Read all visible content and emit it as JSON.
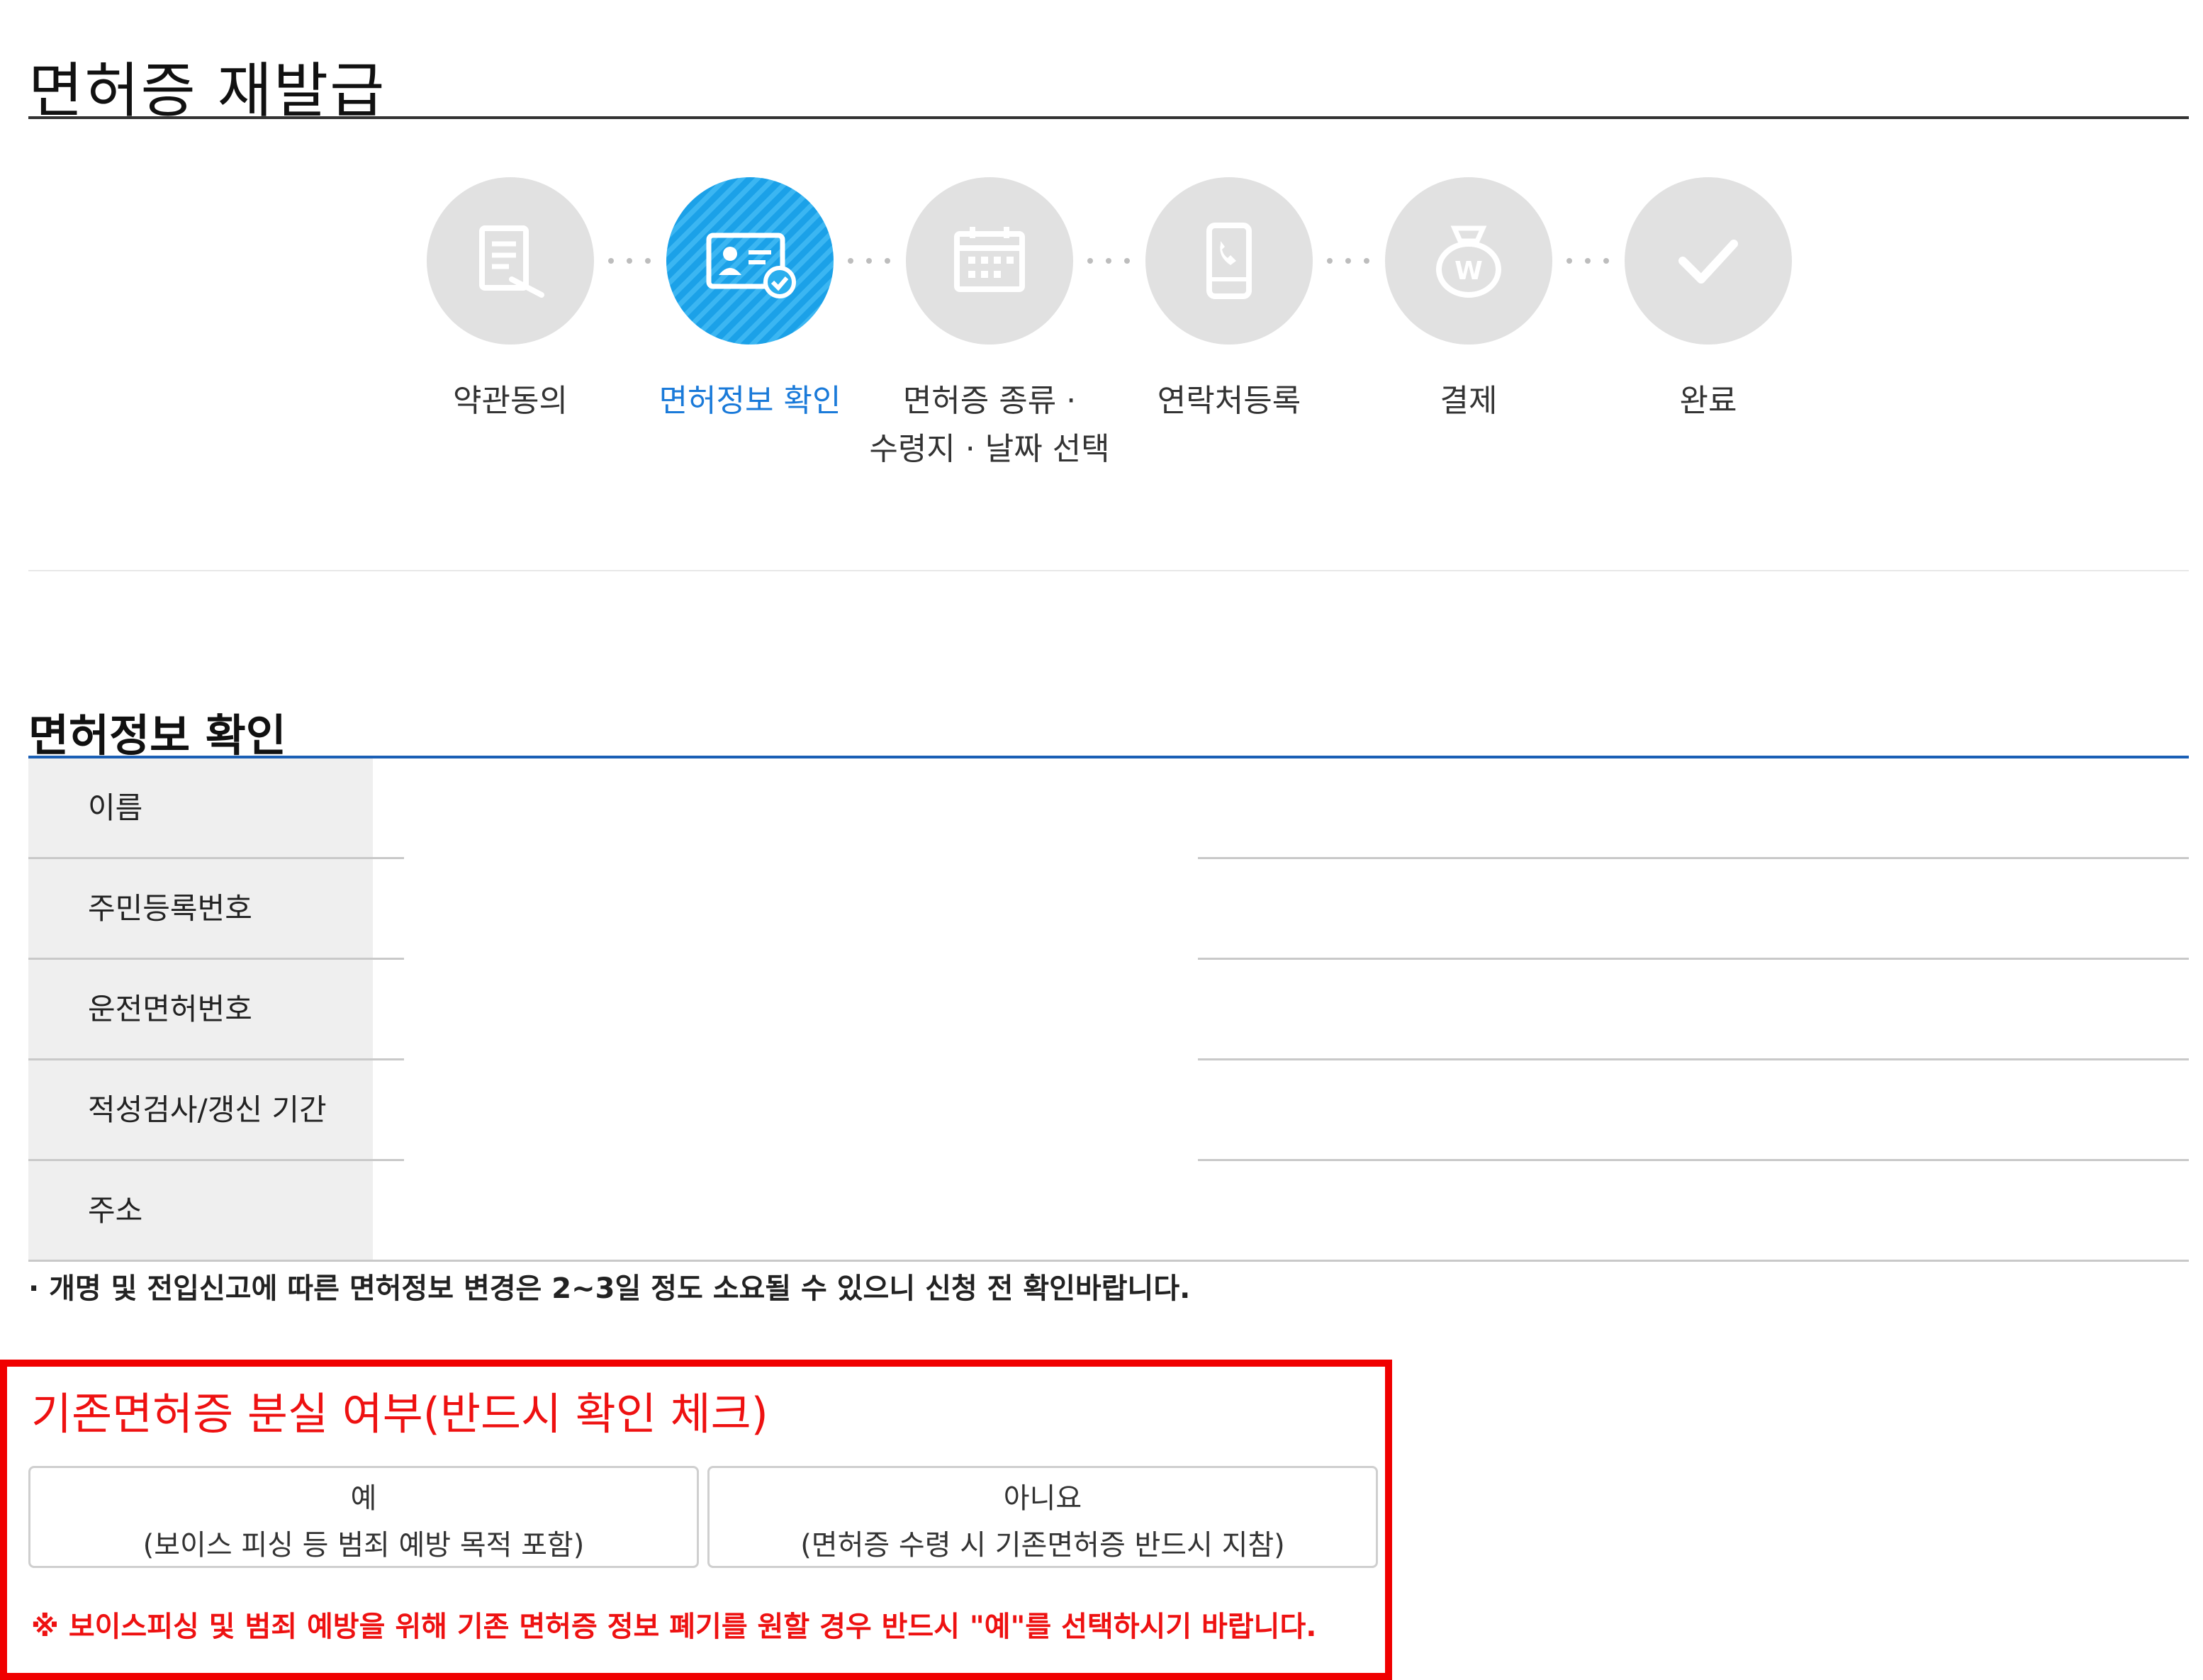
{
  "page": {
    "title": "면허증 재발급"
  },
  "steps": [
    {
      "label": "약관동의",
      "icon": "document-pen-icon"
    },
    {
      "label": "면허정보 확인",
      "icon": "id-card-check-icon",
      "active": true
    },
    {
      "label_line1": "면허증 종류 ·",
      "label_line2": "수령지 · 날짜 선택",
      "icon": "calendar-icon"
    },
    {
      "label": "연락처등록",
      "icon": "phone-icon"
    },
    {
      "label": "결제",
      "icon": "money-bag-icon"
    },
    {
      "label": "완료",
      "icon": "checkmark-icon"
    }
  ],
  "section": {
    "title": "면허정보 확인",
    "rows": [
      "이름",
      "주민등록번호",
      "운전면허번호",
      "적성검사/갱신 기간",
      "주소"
    ],
    "note": "· 개명 및 전입신고에 따른 면허정보 변경은 2~3일 정도 소요될 수 있으니 신청 전 확인바랍니다."
  },
  "loss_check": {
    "title": "기존면허증 분실 여부(반드시 확인 체크)",
    "yes_label": "예",
    "yes_sub": "(보이스 피싱 등 범죄 예방 목적 포함)",
    "no_label": "아니요",
    "no_sub": "(면허증 수령 시 기존면허증 반드시 지참)",
    "warning": "※ 보이스피싱 및 범죄 예방을 위해 기존 면허증 정보 폐기를 원할 경우 반드시 \"예\"를 선택하시기 바랍니다."
  },
  "colors": {
    "accent_blue": "#1a7ad9",
    "active_step": "#1ba1e8",
    "alert_red": "#ee1111",
    "inactive_step": "#e1e1e1"
  }
}
